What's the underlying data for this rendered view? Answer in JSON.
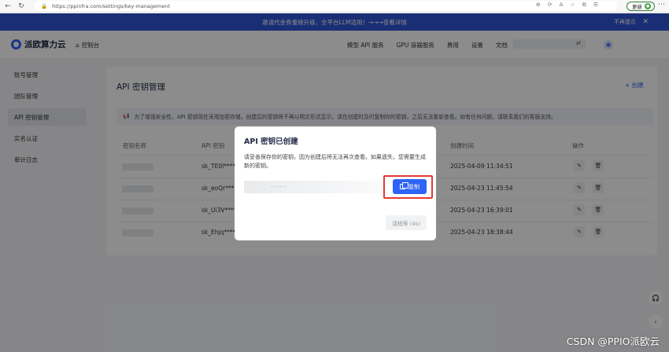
{
  "browser": {
    "url": "https://ppinfra.com/settings/key-management",
    "update_label": "更新"
  },
  "announce": {
    "text": "邀请代金券重磅升级，全平台LLM适用！→→→查看详情",
    "no_remind": "不再提示"
  },
  "header": {
    "brand": "派欧算力云",
    "console": "控制台",
    "menu": [
      "模型 API 服务",
      "GPU 容器服务",
      "费用",
      "设置",
      "文档"
    ]
  },
  "sidebar": {
    "items": [
      "账号管理",
      "团队管理",
      "API 密钥管理",
      "实名认证",
      "审计日志"
    ]
  },
  "main": {
    "title": "API 密钥管理",
    "create_label": "+ 创建",
    "notice": "为了增强安全性，API 密钥现在采用加密存储。创建后的密钥将不再以明文形式显示。请在创建时及时复制你的密钥，之后无法重新查看。如有任何问题，请联系我们的客服支持。",
    "columns": [
      "密钥名称",
      "API 密钥",
      "创建时间",
      "操作"
    ],
    "rows": [
      {
        "key": "sk_TE0l****a",
        "time": "2025-04-09 11:34:51"
      },
      {
        "key": "sk_eoQr****",
        "time": "2025-04-23 11:45:54"
      },
      {
        "key": "sk_Ui3V****",
        "time": "2025-04-23 16:39:01"
      },
      {
        "key": "sk_Ehjq****",
        "time": "2025-04-23 18:38:44"
      }
    ]
  },
  "modal": {
    "title": "API 密钥已创建",
    "desc": "请妥善保存你的密钥，因为创建后将无法再次查看。如果遗失，您需要生成新的密钥。",
    "key_value": "·······",
    "copy_label": "复制",
    "wait_label": "请稍等 (4s)"
  },
  "watermark": "CSDN @PPIO派欧云",
  "colors": {
    "accent": "#2e64f6",
    "highlight": "#e53935",
    "announce_bg": "#2f55d4"
  }
}
